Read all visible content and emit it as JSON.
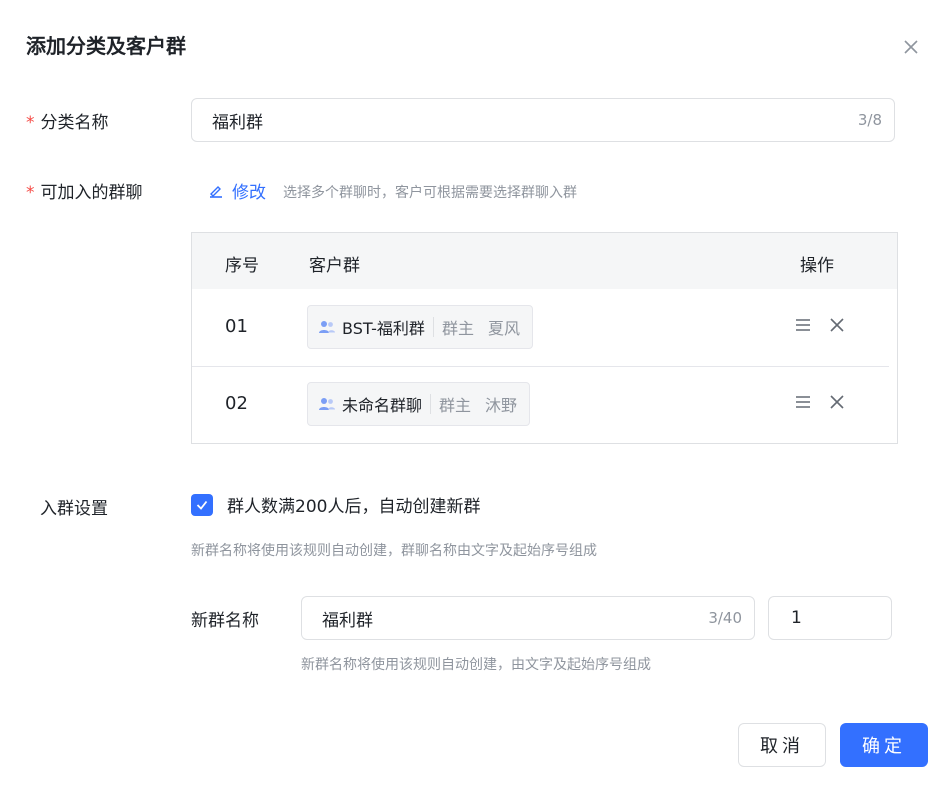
{
  "dialog": {
    "title": "添加分类及客户群"
  },
  "category": {
    "label": "分类名称",
    "required_mark": "*",
    "value": "福利群",
    "count": "3/8"
  },
  "groups": {
    "label": "可加入的群聊",
    "required_mark": "*",
    "edit_label": "修改",
    "hint": "选择多个群聊时，客户可根据需要选择群聊入群",
    "table": {
      "headers": {
        "index": "序号",
        "group": "客户群",
        "actions": "操作"
      },
      "rows": [
        {
          "index": "01",
          "name": "BST-福利群",
          "owner_label": "群主",
          "owner": "夏风"
        },
        {
          "index": "02",
          "name": "未命名群聊",
          "owner_label": "群主",
          "owner": "沐野"
        }
      ]
    }
  },
  "join_settings": {
    "label": "入群设置",
    "checkbox_checked": true,
    "checkbox_label": "群人数满200人后，自动创建新群",
    "hint": "新群名称将使用该规则自动创建，群聊名称由文字及起始序号组成",
    "new_name": {
      "label": "新群名称",
      "value": "福利群",
      "count": "3/40",
      "start_index": "1",
      "hint": "新群名称将使用该规则自动创建，由文字及起始序号组成"
    }
  },
  "footer": {
    "cancel_label": "取消",
    "ok_label": "确定"
  },
  "colors": {
    "primary": "#3370ff",
    "required": "#f54a45",
    "muted": "#8f959e"
  }
}
